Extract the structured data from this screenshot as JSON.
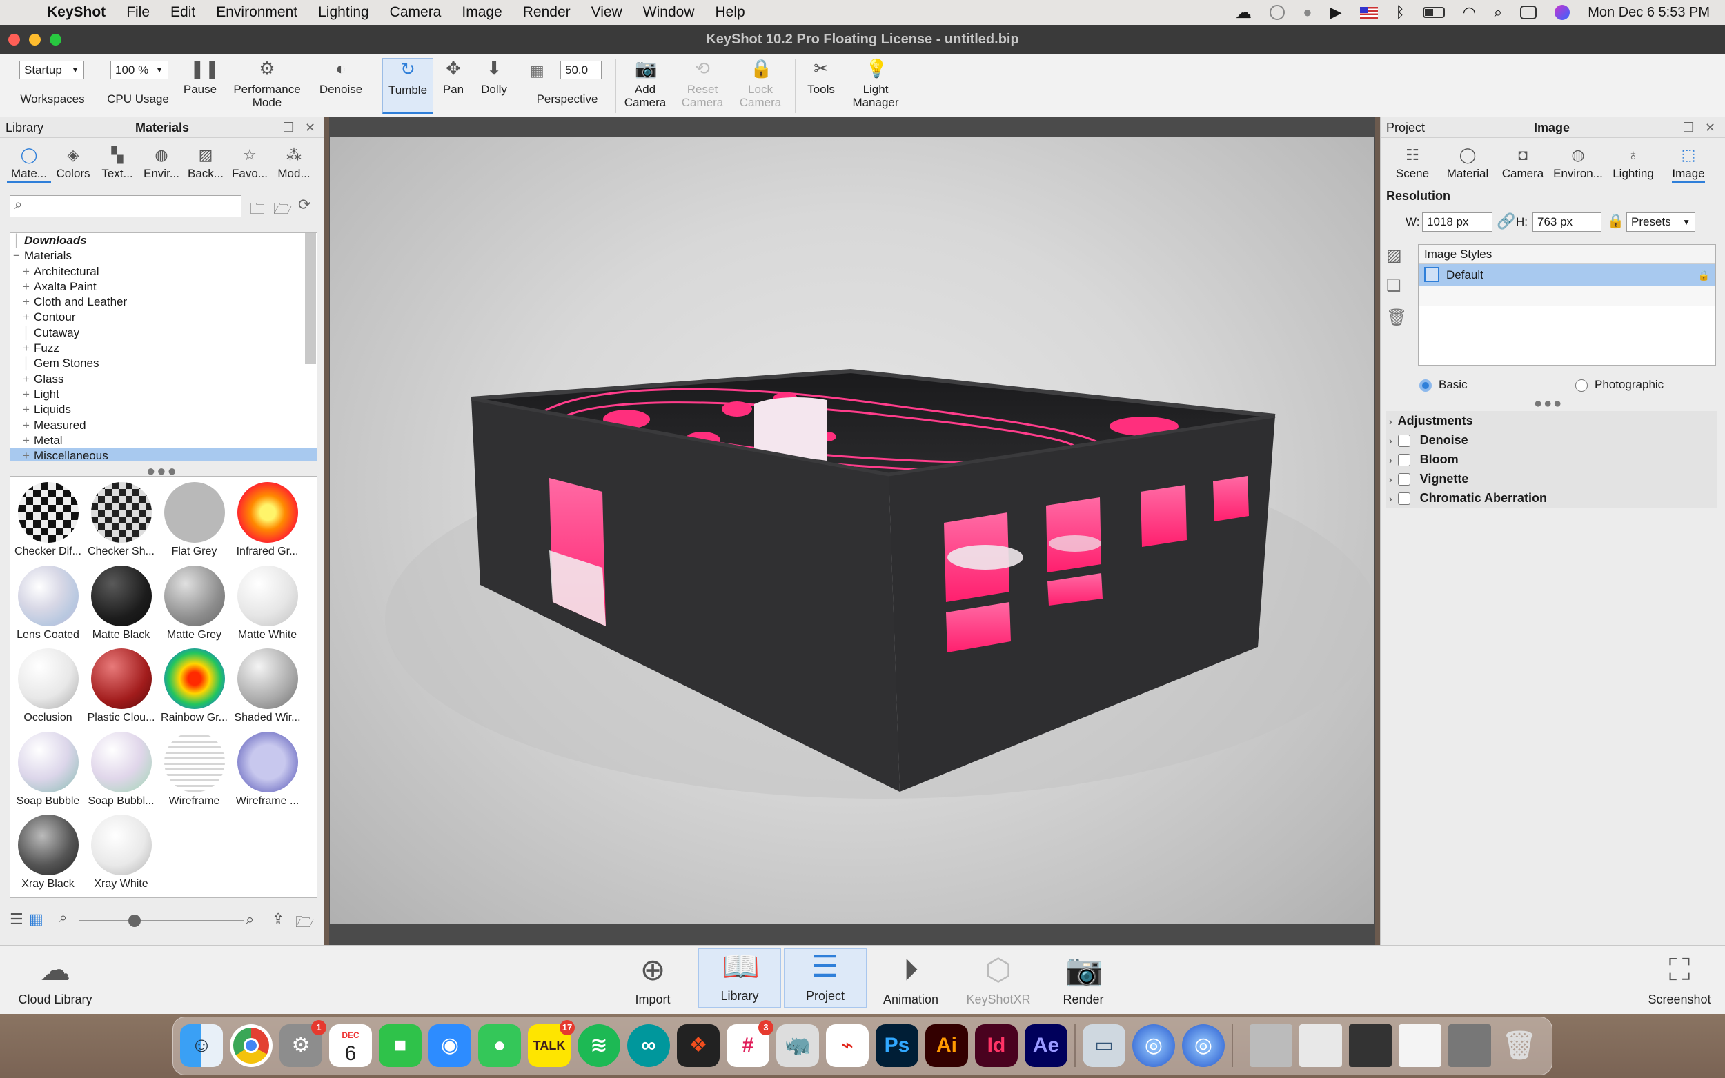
{
  "menubar": {
    "app": "KeyShot",
    "items": [
      "File",
      "Edit",
      "Environment",
      "Lighting",
      "Camera",
      "Image",
      "Render",
      "View",
      "Window",
      "Help"
    ],
    "clock": "Mon Dec 6  5:53 PM"
  },
  "window": {
    "title": "KeyShot 10.2 Pro Floating License  - untitled.bip"
  },
  "toolbar": {
    "workspace_value": "Startup",
    "workspaces_label": "Workspaces",
    "cpu_value": "100 %",
    "cpu_label": "CPU Usage",
    "pause": "Pause",
    "performance": "Performance\nMode",
    "denoise": "Denoise",
    "tumble": "Tumble",
    "pan": "Pan",
    "dolly": "Dolly",
    "fov_value": "50.0",
    "perspective": "Perspective",
    "add_camera": "Add\nCamera",
    "reset_camera": "Reset\nCamera",
    "lock_camera": "Lock\nCamera",
    "tools": "Tools",
    "light_manager": "Light\nManager"
  },
  "library": {
    "header_left": "Library",
    "header_title": "Materials",
    "tabs": [
      "Mate...",
      "Colors",
      "Text...",
      "Envir...",
      "Back...",
      "Favo...",
      "Mod..."
    ],
    "search_placeholder": "",
    "tree": [
      {
        "label": "Downloads",
        "kind": "italic"
      },
      {
        "label": "Materials",
        "kind": "root"
      },
      {
        "label": "Architectural",
        "kind": "plus"
      },
      {
        "label": "Axalta Paint",
        "kind": "plus"
      },
      {
        "label": "Cloth and Leather",
        "kind": "plus"
      },
      {
        "label": "Contour",
        "kind": "plus"
      },
      {
        "label": "Cutaway",
        "kind": "leaf"
      },
      {
        "label": "Fuzz",
        "kind": "plus"
      },
      {
        "label": "Gem Stones",
        "kind": "leaf"
      },
      {
        "label": "Glass",
        "kind": "plus"
      },
      {
        "label": "Light",
        "kind": "plus"
      },
      {
        "label": "Liquids",
        "kind": "plus"
      },
      {
        "label": "Measured",
        "kind": "plus"
      },
      {
        "label": "Metal",
        "kind": "plus"
      },
      {
        "label": "Miscellaneous",
        "kind": "plus",
        "selected": true
      }
    ],
    "swatches": [
      {
        "label": "Checker Dif...",
        "style": "checker"
      },
      {
        "label": "Checker Sh...",
        "style": "checker2"
      },
      {
        "label": "Flat Grey",
        "style": "flat"
      },
      {
        "label": "Infrared Gr...",
        "style": "infrared"
      },
      {
        "label": "Lens Coated",
        "style": "lens"
      },
      {
        "label": "Matte Black",
        "style": "black"
      },
      {
        "label": "Matte Grey",
        "style": "grey"
      },
      {
        "label": "Matte White",
        "style": "white"
      },
      {
        "label": "Occlusion",
        "style": "occl"
      },
      {
        "label": "Plastic Clou...",
        "style": "red"
      },
      {
        "label": "Rainbow Gr...",
        "style": "rainbow"
      },
      {
        "label": "Shaded Wir...",
        "style": "shaded"
      },
      {
        "label": "Soap Bubble",
        "style": "soap"
      },
      {
        "label": "Soap Bubbl...",
        "style": "soap2"
      },
      {
        "label": "Wireframe",
        "style": "wire"
      },
      {
        "label": "Wireframe ...",
        "style": "wire2"
      },
      {
        "label": "Xray Black",
        "style": "xblack"
      },
      {
        "label": "Xray White",
        "style": "xwhite"
      }
    ]
  },
  "project": {
    "header_left": "Project",
    "header_title": "Image",
    "tabs": [
      "Scene",
      "Material",
      "Camera",
      "Environ...",
      "Lighting",
      "Image"
    ],
    "resolution_label": "Resolution",
    "w_label": "W:",
    "w_value": "1018 px",
    "h_label": "H:",
    "h_value": "763 px",
    "presets": "Presets",
    "image_styles_label": "Image Styles",
    "style_default": "Default",
    "mode_basic": "Basic",
    "mode_photographic": "Photographic",
    "adjustments_label": "Adjustments",
    "adjust_items": [
      "Denoise",
      "Bloom",
      "Vignette",
      "Chromatic Aberration"
    ]
  },
  "bottombar": {
    "cloud_library": "Cloud Library",
    "import": "Import",
    "library": "Library",
    "project": "Project",
    "animation": "Animation",
    "keyshotxr": "KeyShotXR",
    "render": "Render",
    "screenshot": "Screenshot"
  },
  "dock": {
    "calendar_month": "DEC",
    "calendar_day": "6",
    "badges": {
      "settings": "1",
      "talk": "17",
      "slack": "3"
    },
    "labels": {
      "talk": "TALK",
      "ps": "Ps",
      "ai": "Ai",
      "id": "Id",
      "ae": "Ae"
    }
  },
  "colors": {
    "accent": "#2f7fd9",
    "scene_pink": "#ff2f7d",
    "box_dark": "#2f2f31"
  }
}
